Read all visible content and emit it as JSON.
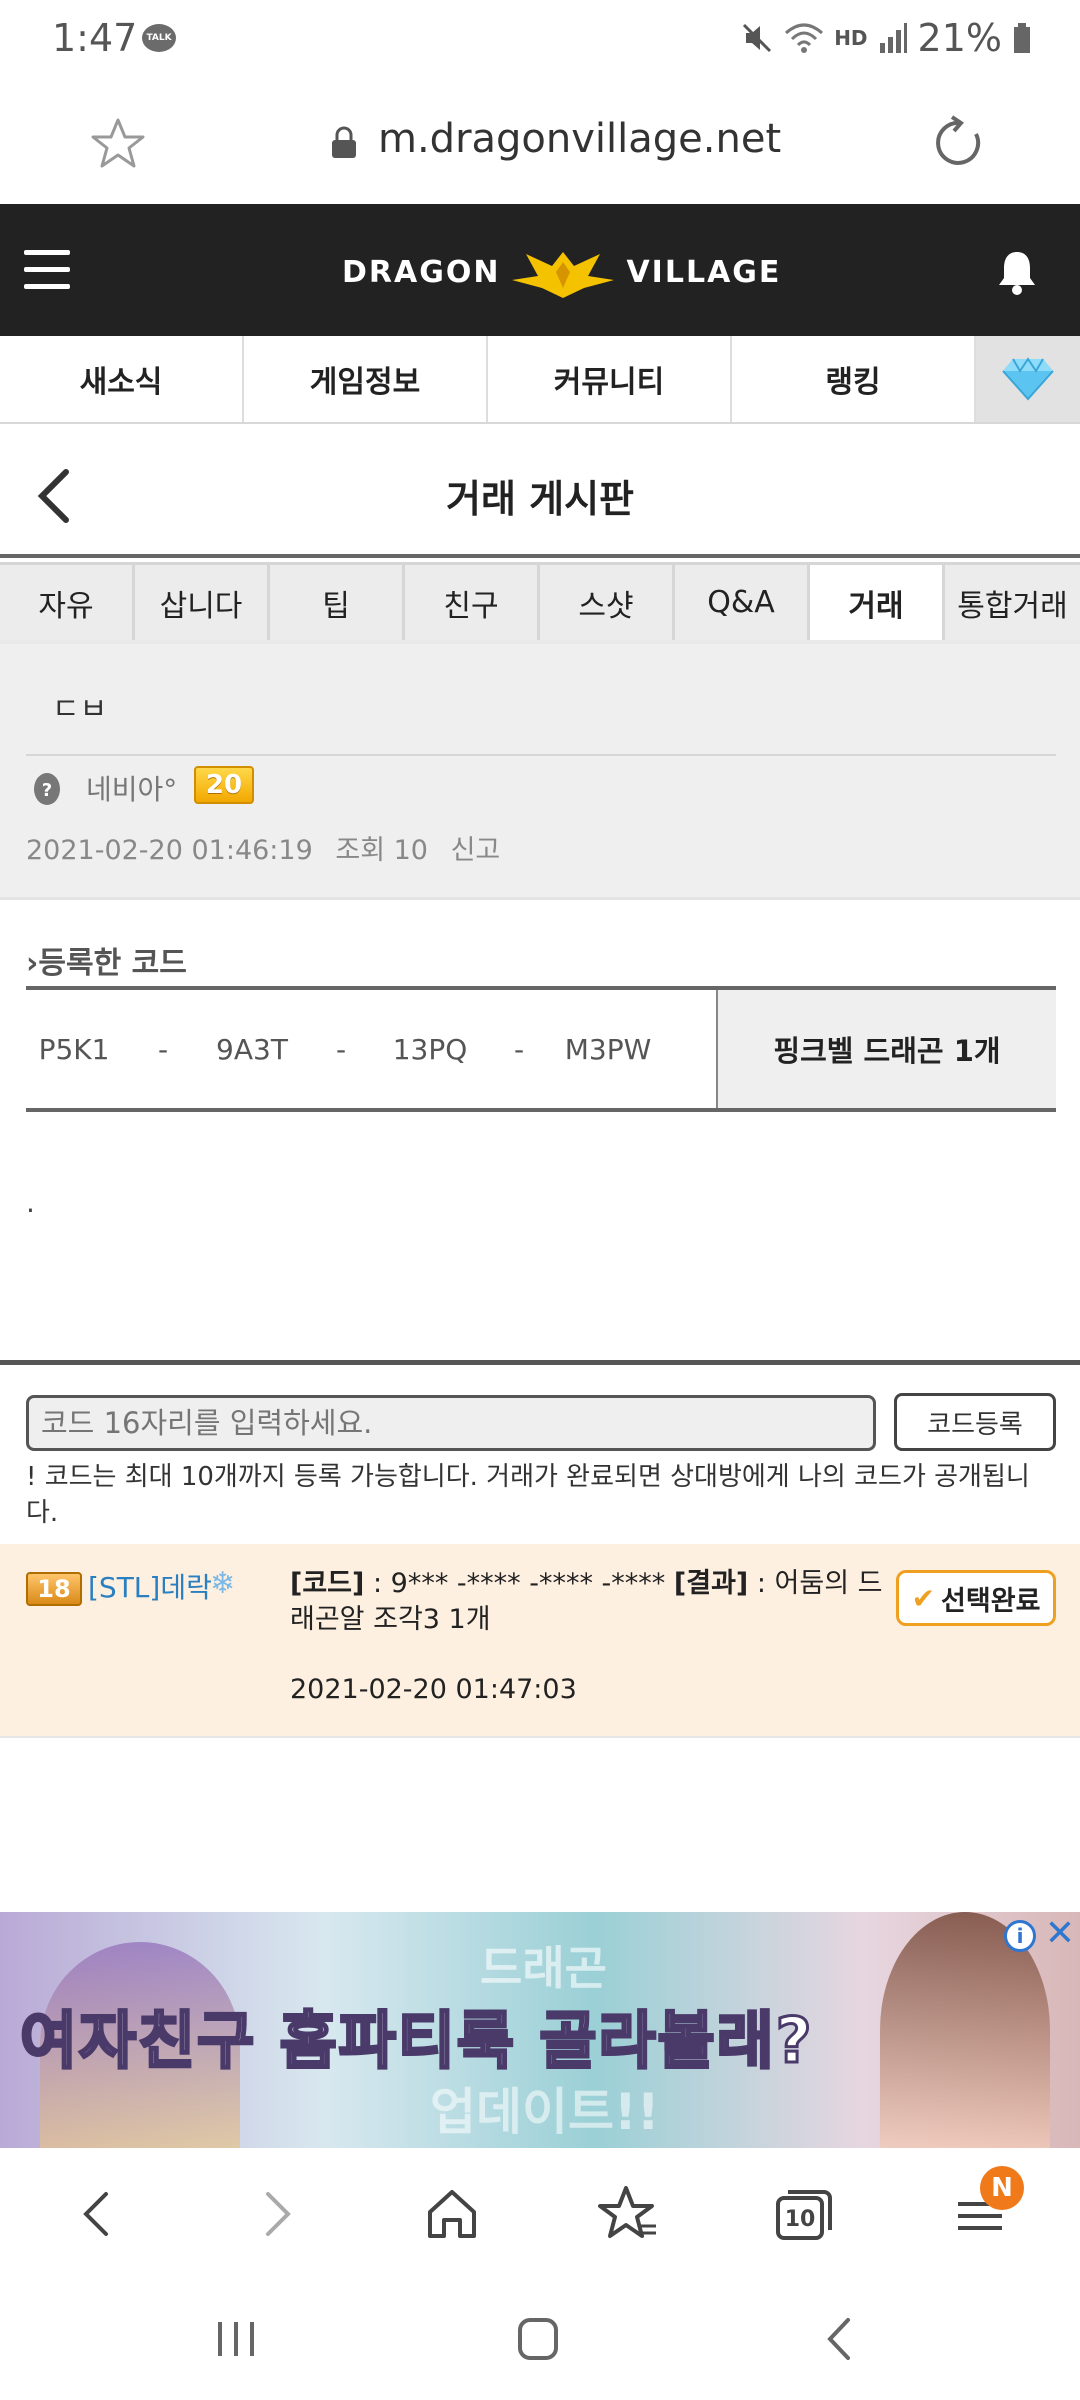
{
  "status_bar": {
    "time": "1:47",
    "talk_label": "TALK",
    "hd_label": "HD",
    "battery": "21%"
  },
  "browser": {
    "url": "m.dragonvillage.net"
  },
  "site": {
    "logo_left": "DRAGON",
    "logo_right": "VILLAGE"
  },
  "main_nav": {
    "items": [
      {
        "label": "새소식"
      },
      {
        "label": "게임정보"
      },
      {
        "label": "커뮤니티"
      },
      {
        "label": "랭킹"
      }
    ]
  },
  "page": {
    "title": "거래 게시판"
  },
  "board_tabs": {
    "items": [
      {
        "label": "자유"
      },
      {
        "label": "삽니다"
      },
      {
        "label": "팁"
      },
      {
        "label": "친구"
      },
      {
        "label": "스샷"
      },
      {
        "label": "Q&A"
      },
      {
        "label": "거래"
      },
      {
        "label": "통합거래"
      }
    ],
    "active": "거래"
  },
  "post": {
    "title": "ㄷㅂ",
    "author": "네비아°",
    "author_level": "20",
    "date": "2021-02-20 01:46:19",
    "views": "조회 10",
    "report": "신고",
    "body": "."
  },
  "code_section": {
    "title": "등록한 코드",
    "parts": [
      "P5K1",
      "9A3T",
      "13PQ",
      "M3PW"
    ],
    "separator": "-",
    "reward": "핑크벨 드래곤 1개"
  },
  "code_input": {
    "placeholder": "코드 16자리를 입력하세요.",
    "submit_label": "코드등록",
    "notice": "! 코드는 최대 10개까지 등록 가능합니다. 거래가 완료되면 상대방에게 나의 코드가 공개됩니다."
  },
  "comment": {
    "level": "18",
    "user": "[STL]데락",
    "snowflake": "❄",
    "code_label": "[코드]",
    "code_value": " : 9*** -**** -**** -****",
    "result_label": "[결과]",
    "result_value": " : 어둠의 드래곤알 조각3 1개",
    "date": "2021-02-20 01:47:03",
    "select_label": "선택완료"
  },
  "ad": {
    "headline": "여자친구 홈파티룩 골라볼래?",
    "bg_text_1": "드래곤",
    "bg_text_2": "업데이트!!"
  },
  "browser_bar": {
    "tab_count": "10",
    "notification_badge": "N"
  },
  "colors": {
    "header_bg": "#222222",
    "accent_orange": "#f0a020",
    "comment_bg": "#fdf0e1",
    "user_link": "#2a7fc0"
  }
}
